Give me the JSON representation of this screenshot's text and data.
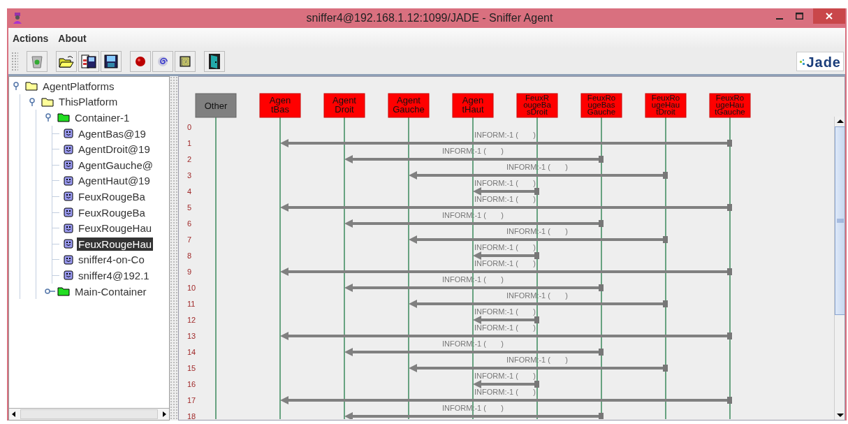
{
  "window": {
    "title": "sniffer4@192.168.1.12:1099/JADE - Sniffer Agent"
  },
  "menu": [
    {
      "label": "Actions"
    },
    {
      "label": "About"
    }
  ],
  "toolbar": [
    {
      "kind": "trash"
    },
    {
      "kind": "separator"
    },
    {
      "kind": "open"
    },
    {
      "kind": "saveas"
    },
    {
      "kind": "save"
    },
    {
      "kind": "separator"
    },
    {
      "kind": "record"
    },
    {
      "kind": "spiral"
    },
    {
      "kind": "square"
    },
    {
      "kind": "separator"
    },
    {
      "kind": "exit"
    }
  ],
  "logo": "Jade",
  "tree": [
    {
      "label": "AgentPlatforms",
      "kind": "folder",
      "expanded": true,
      "selected": false,
      "children": [
        {
          "label": "ThisPlatform",
          "kind": "folder",
          "expanded": true,
          "selected": false,
          "children": [
            {
              "label": "Container-1",
              "kind": "container",
              "expanded": true,
              "selected": false,
              "children": [
                {
                  "label": "AgentBas@19",
                  "kind": "agent",
                  "selected": false
                },
                {
                  "label": "AgentDroit@19",
                  "kind": "agent",
                  "selected": false
                },
                {
                  "label": "AgentGauche@",
                  "kind": "agent",
                  "selected": false
                },
                {
                  "label": "AgentHaut@19",
                  "kind": "agent",
                  "selected": false
                },
                {
                  "label": "FeuxRougeBa",
                  "kind": "agent",
                  "selected": false
                },
                {
                  "label": "FeuxRougeBa",
                  "kind": "agent",
                  "selected": false
                },
                {
                  "label": "FeuxRougeHau",
                  "kind": "agent",
                  "selected": false
                },
                {
                  "label": "FeuxRougeHau",
                  "kind": "agent",
                  "selected": true
                },
                {
                  "label": "sniffer4-on-Co",
                  "kind": "agent",
                  "selected": false
                },
                {
                  "label": "sniffer4@192.1",
                  "kind": "agent",
                  "selected": false
                }
              ]
            },
            {
              "label": "Main-Container",
              "kind": "container",
              "expanded": false,
              "selected": false
            }
          ]
        }
      ]
    }
  ],
  "agents": [
    {
      "kind": "other",
      "lines": [
        "Other"
      ]
    },
    {
      "kind": "agent",
      "lines": [
        "Agen",
        "tBas"
      ]
    },
    {
      "kind": "agent",
      "lines": [
        "Agent",
        "Droit"
      ]
    },
    {
      "kind": "agent",
      "lines": [
        "Agent",
        "Gauche"
      ]
    },
    {
      "kind": "agent",
      "lines": [
        "Agen",
        "tHaut"
      ]
    },
    {
      "kind": "agent",
      "lines": [
        "FeuxR",
        "ougeBa",
        "sDroit"
      ]
    },
    {
      "kind": "agent",
      "lines": [
        "FeuxRo",
        "ugeBas",
        "Gauche"
      ]
    },
    {
      "kind": "agent",
      "lines": [
        "FeuxRo",
        "ugeHau",
        "tDroit"
      ]
    },
    {
      "kind": "agent",
      "lines": [
        "FeuxRo",
        "ugeHau",
        "tGauche"
      ]
    }
  ],
  "rows": [
    {
      "number": "0"
    },
    {
      "number": "1",
      "kind": "long",
      "label": "INFORM:-1 (       )"
    },
    {
      "number": "2",
      "kind": "wide",
      "label": "INFORM:-1 (       )"
    },
    {
      "number": "3",
      "kind": "middle",
      "label": "INFORM:-1 (       )"
    },
    {
      "number": "4",
      "kind": "short",
      "label": "INFORM:-1 (       )"
    },
    {
      "number": "5",
      "kind": "long",
      "label": "INFORM:-1 (       )"
    },
    {
      "number": "6",
      "kind": "wide",
      "label": "INFORM:-1 (       )"
    },
    {
      "number": "7",
      "kind": "middle",
      "label": "INFORM:-1 (       )"
    },
    {
      "number": "8",
      "kind": "short",
      "label": "INFORM:-1 (       )"
    },
    {
      "number": "9",
      "kind": "long",
      "label": "INFORM:-1 (       )"
    },
    {
      "number": "10",
      "kind": "wide",
      "label": "INFORM:-1 (       )"
    },
    {
      "number": "11",
      "kind": "middle",
      "label": "INFORM:-1 (       )"
    },
    {
      "number": "12",
      "kind": "short",
      "label": "INFORM:-1 (       )"
    },
    {
      "number": "13",
      "kind": "long",
      "label": "INFORM:-1 (       )"
    },
    {
      "number": "14",
      "kind": "wide",
      "label": "INFORM:-1 (       )"
    },
    {
      "number": "15",
      "kind": "middle",
      "label": "INFORM:-1 (       )"
    },
    {
      "number": "16",
      "kind": "short",
      "label": "INFORM:-1 (       )"
    },
    {
      "number": "17",
      "kind": "long",
      "label": "INFORM:-1 (       )"
    },
    {
      "number": "18",
      "kind": "wide",
      "label": "INFORM:-1 (       )"
    }
  ]
}
